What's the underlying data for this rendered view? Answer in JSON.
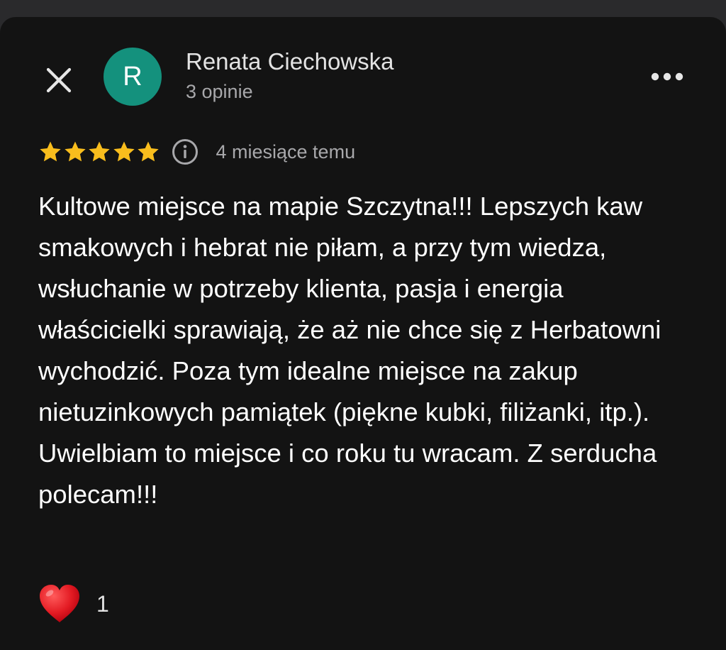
{
  "reviewer": {
    "initial": "R",
    "name": "Renata Ciechowska",
    "review_count": "3 opinie",
    "avatar_color": "#14917d"
  },
  "rating": {
    "stars": 5,
    "star_color": "#f8bd1d",
    "date": "4 miesiące temu"
  },
  "review": {
    "text": "Kultowe miejsce na mapie Szczytna!!! Lepszych kaw smakowych i hebrat nie piłam, a przy tym wiedza, wsłuchanie w potrzeby klienta, pasja i energia właścicielki sprawiają, że aż nie chce się z Herbatowni wychodzić. Poza tym idealne miejsce na zakup nietuzinkowych pamiątek (piękne kubki, filiżanki, itp.). Uwielbiam to miejsce i co roku tu wracam. Z serducha polecam!!!"
  },
  "reaction": {
    "icon": "heart-icon",
    "count": "1"
  },
  "icons": {
    "close": "close-icon",
    "more": "more-options-icon",
    "info": "info-icon"
  }
}
